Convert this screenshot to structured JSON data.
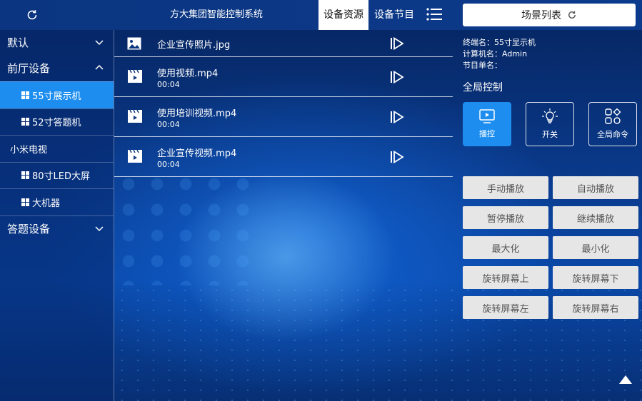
{
  "header": {
    "title": "方大集团智能控制系统",
    "tabs": [
      {
        "label": "设备资源",
        "active": true
      },
      {
        "label": "设备节目",
        "active": false
      }
    ],
    "scene_list_label": "场景列表"
  },
  "sidebar": {
    "groups": [
      {
        "label": "默认",
        "expanded": false
      },
      {
        "label": "前厅设备",
        "expanded": true,
        "items": [
          {
            "label": "55寸展示机",
            "active": true
          },
          {
            "label": "52寸答题机",
            "active": false
          },
          {
            "label": "小米电视",
            "active": false
          },
          {
            "label": "80寸LED大屏",
            "active": false
          },
          {
            "label": "大机器",
            "active": false
          }
        ]
      },
      {
        "label": "答题设备",
        "expanded": false
      }
    ]
  },
  "files": [
    {
      "name": "企业宣传照片.jpg",
      "type": "image",
      "duration": ""
    },
    {
      "name": "使用视频.mp4",
      "type": "video",
      "duration": "00:04"
    },
    {
      "name": "使用培训视频.mp4",
      "type": "video",
      "duration": "00:04"
    },
    {
      "name": "企业宣传视频.mp4",
      "type": "video",
      "duration": "00:04"
    }
  ],
  "info": {
    "terminal": "终端名：55寸显示机",
    "computer": "计算机名：Admin",
    "program": "节目单名："
  },
  "global_control": {
    "title": "全局控制",
    "modes": [
      {
        "label": "播控",
        "icon": "monitor-play-icon",
        "active": true
      },
      {
        "label": "开关",
        "icon": "lightbulb-icon",
        "active": false
      },
      {
        "label": "全局命令",
        "icon": "apps-grid-icon",
        "active": false
      }
    ],
    "commands": [
      "手动播放",
      "自动播放",
      "暂停播放",
      "继续播放",
      "最大化",
      "最小化",
      "旋转屏幕上",
      "旋转屏幕下",
      "旋转屏幕左",
      "旋转屏幕右"
    ]
  },
  "colors": {
    "accent": "#1d8ef0",
    "header_bg": "#0c3a8c",
    "button_bg": "#e6e6e6"
  }
}
